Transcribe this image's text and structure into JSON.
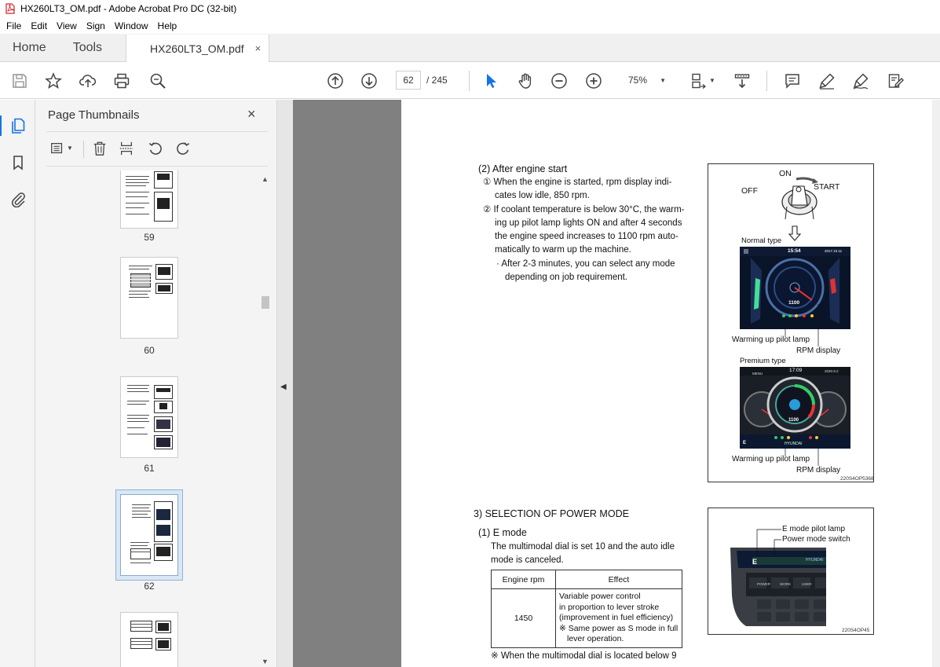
{
  "window": {
    "title": "HX260LT3_OM.pdf - Adobe Acrobat Pro DC (32-bit)"
  },
  "menubar": {
    "items": [
      "File",
      "Edit",
      "View",
      "Sign",
      "Window",
      "Help"
    ]
  },
  "tabs": {
    "home": "Home",
    "tools": "Tools",
    "document": "HX260LT3_OM.pdf",
    "close": "×"
  },
  "toolbar": {
    "page_current": "62",
    "page_total": "/ 245",
    "zoom": "75%",
    "icons": [
      "save-icon",
      "star-icon",
      "upload-icon",
      "print-icon",
      "search-icon",
      "page-up-icon",
      "page-down-icon",
      "select-cursor-icon",
      "hand-icon",
      "zoom-out-icon",
      "zoom-in-icon",
      "fit-page-icon",
      "scroll-mode-icon",
      "comment-icon",
      "highlight-icon",
      "sign-icon",
      "edit-pdf-icon"
    ]
  },
  "thumbnails": {
    "title": "Page Thumbnails",
    "close": "×",
    "pages": [
      "59",
      "60",
      "61",
      "62"
    ],
    "selected": "62"
  },
  "page": {
    "section2": {
      "heading": "(2) After engine start",
      "item1": "① When the engine is started, rpm display indi-\ncates low idle, 850 rpm.",
      "item1_a": "① When the engine is started, rpm display indi-",
      "item1_b": "cates low idle, 850 rpm.",
      "item2_a": "② If coolant temperature is below 30°C, the warm-",
      "item2_b": "ing up pilot lamp lights ON and after 4 seconds",
      "item2_c": "the engine speed increases to 1100 rpm auto-",
      "item2_d": "matically to warm up the machine.",
      "note_a": "· After 2-3 minutes, you can select any mode",
      "note_b": "depending on job requirement."
    },
    "figure1": {
      "on": "ON",
      "off": "OFF",
      "start": "START",
      "normal_type": "Normal type",
      "normal_time": "15:54",
      "normal_date": "2017.10.11",
      "normal_rpm": "1100",
      "warming_lamp_1": "Warming up pilot lamp",
      "rpm_display_1": "RPM display",
      "premium_type": "Premium type",
      "premium_time": "17:09",
      "premium_date": "2020.9.2",
      "premium_menu": "MENU",
      "premium_rpm": "1100",
      "premium_brand": "HYUNDAI",
      "premium_e": "E",
      "warming_lamp_2": "Warming up pilot lamp",
      "rpm_display_2": "RPM display",
      "code": "220S4OP5368"
    },
    "section3": {
      "heading": "3) SELECTION OF POWER MODE",
      "e_mode": "(1) E mode",
      "desc_a": "The multimodal dial is set 10 and the auto idle",
      "desc_b": "mode is canceled.",
      "table": {
        "col1": "Engine rpm",
        "col2": "Effect",
        "rpm": "1450",
        "effect_1": "Variable power control",
        "effect_2": "in proportion to lever stroke",
        "effect_3": "(improvement in fuel efficiency)",
        "effect_4": "※ Same power as S mode in full",
        "effect_5": "lever operation."
      },
      "footnote": "※  When the multimodal dial is located below 9"
    },
    "figure2": {
      "e_mode_lamp": "E mode pilot lamp",
      "power_switch": "Power mode switch",
      "panel_e": "E",
      "panel_brand": "HYUNDAI",
      "btn_power": "POWER",
      "btn_work": "WORK",
      "btn_user": "USER",
      "code": "220S4OP45"
    }
  }
}
